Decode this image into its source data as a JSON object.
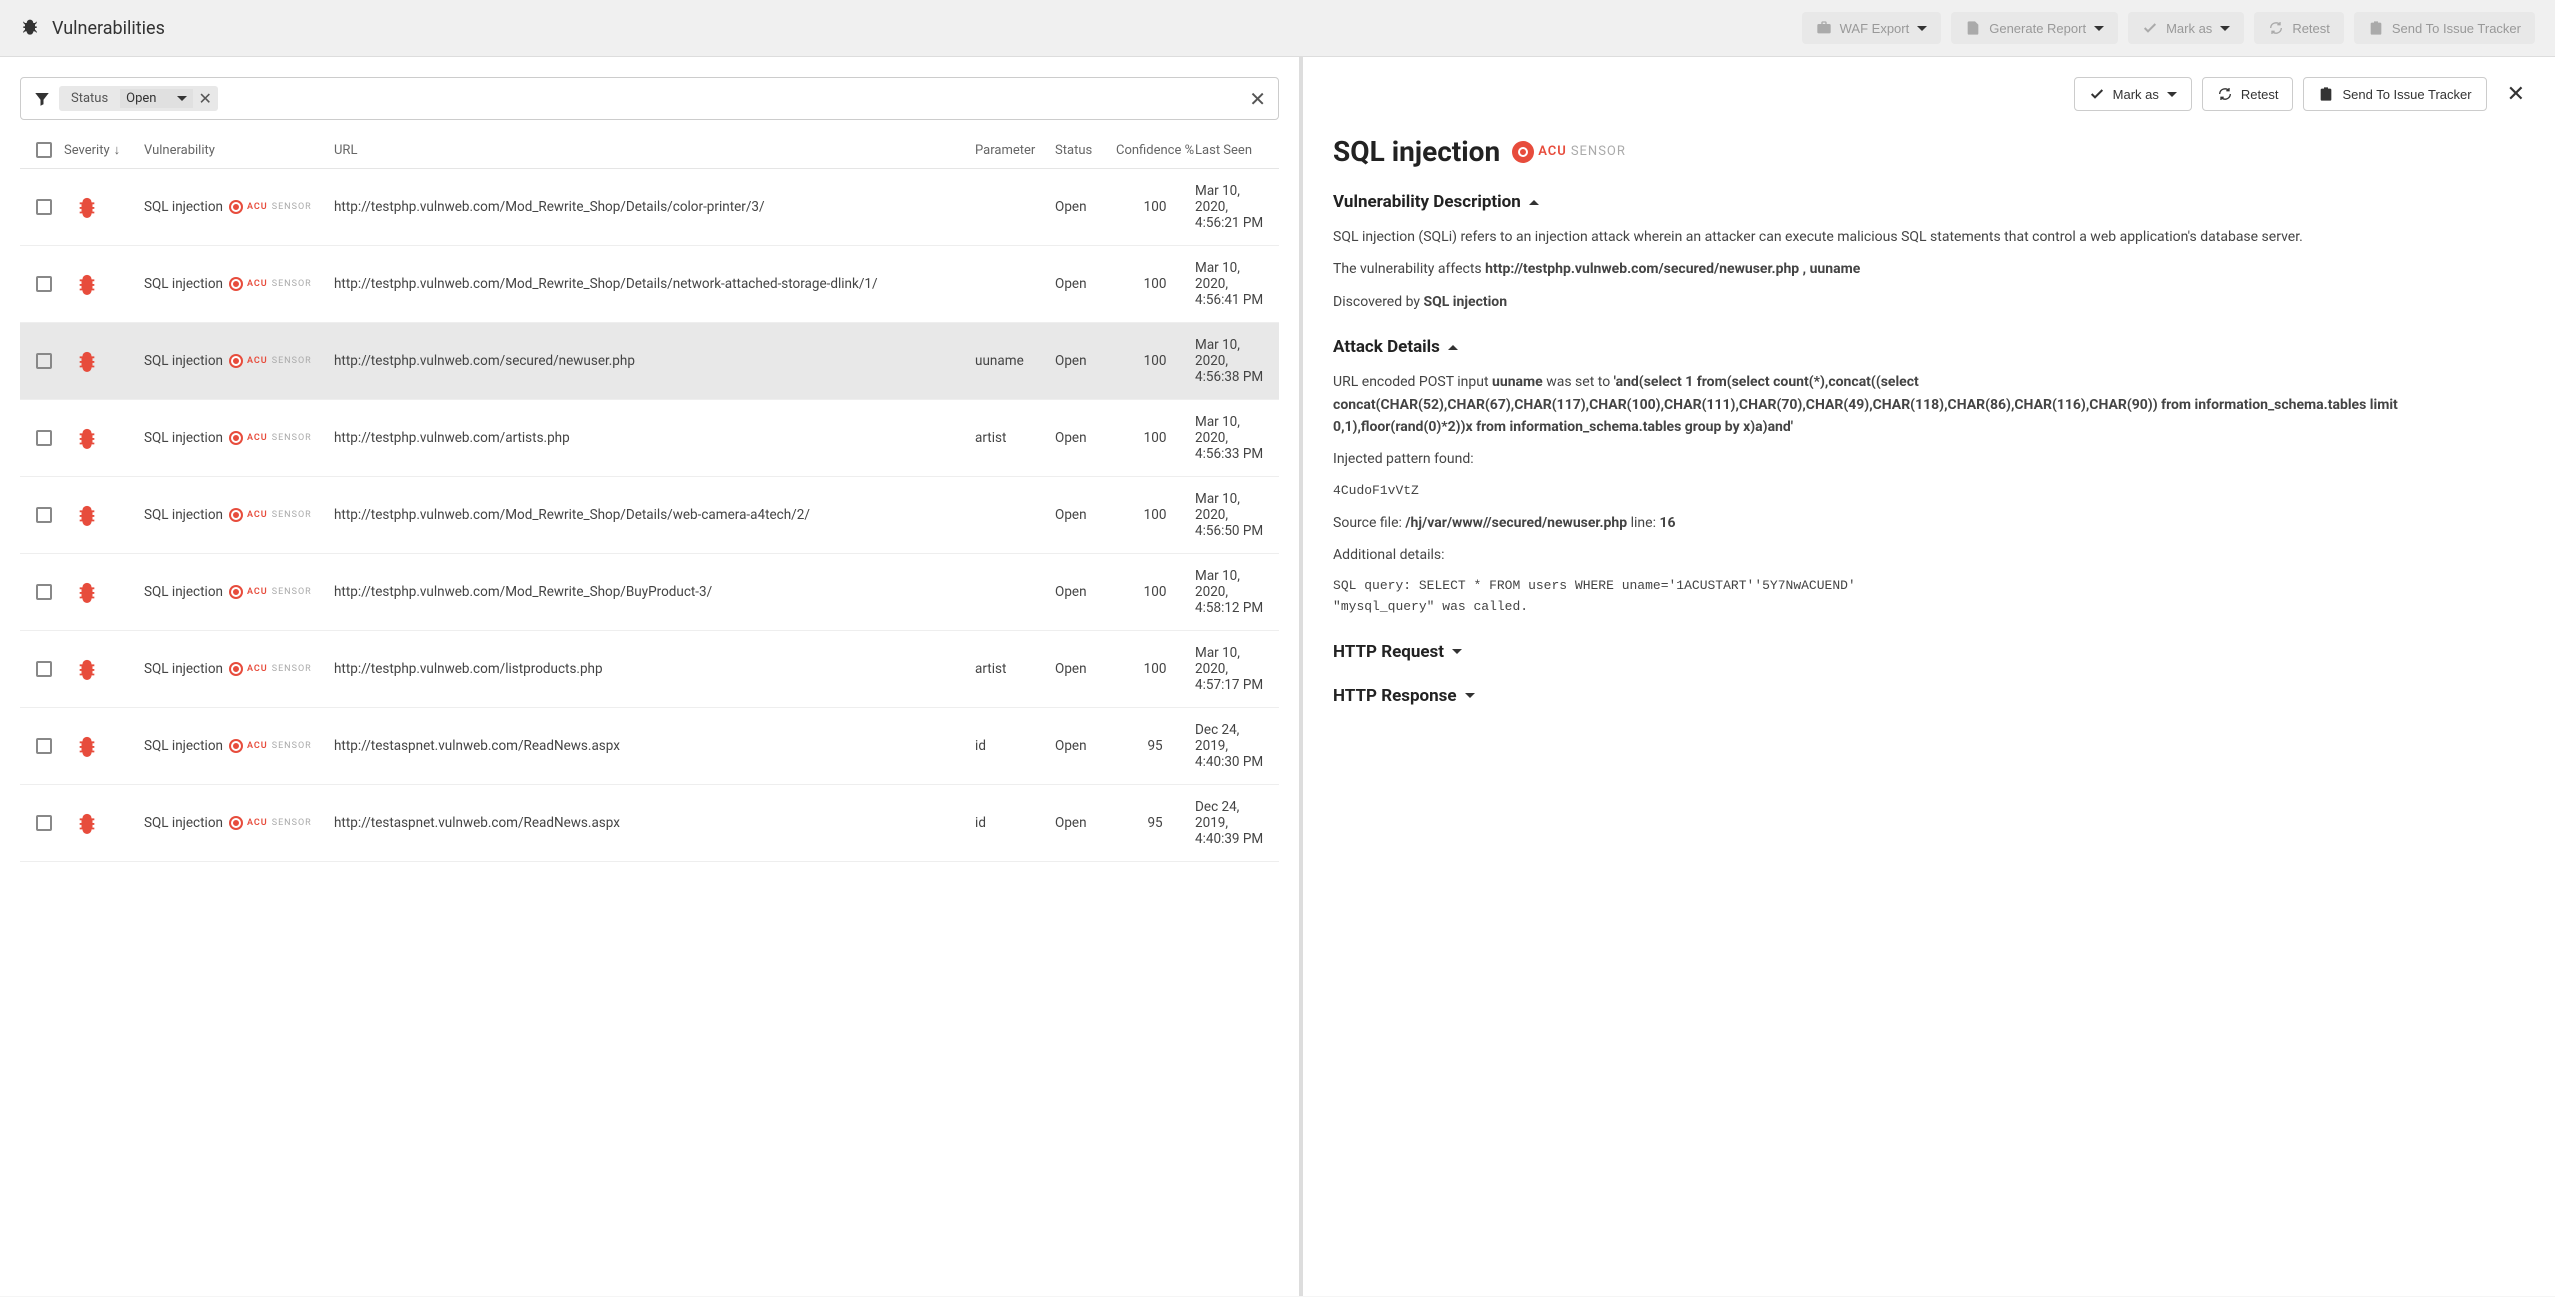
{
  "header": {
    "title": "Vulnerabilities",
    "buttons": {
      "waf_export": "WAF Export",
      "generate_report": "Generate Report",
      "mark_as": "Mark as",
      "retest": "Retest",
      "send_tracker": "Send To Issue Tracker"
    }
  },
  "filter": {
    "label": "Status",
    "value": "Open"
  },
  "columns": {
    "severity": "Severity",
    "vulnerability": "Vulnerability",
    "url": "URL",
    "parameter": "Parameter",
    "status": "Status",
    "confidence": "Confidence %",
    "last_seen": "Last Seen"
  },
  "rows": [
    {
      "vuln": "SQL injection",
      "url": "http://testphp.vulnweb.com/Mod_Rewrite_Shop/Details/color-printer/3/",
      "param": "",
      "status": "Open",
      "conf": "100",
      "seen": "Mar 10, 2020, 4:56:21 PM"
    },
    {
      "vuln": "SQL injection",
      "url": "http://testphp.vulnweb.com/Mod_Rewrite_Shop/Details/network-attached-storage-dlink/1/",
      "param": "",
      "status": "Open",
      "conf": "100",
      "seen": "Mar 10, 2020, 4:56:41 PM"
    },
    {
      "vuln": "SQL injection",
      "url": "http://testphp.vulnweb.com/secured/newuser.php",
      "param": "uuname",
      "status": "Open",
      "conf": "100",
      "seen": "Mar 10, 2020, 4:56:38 PM",
      "selected": true
    },
    {
      "vuln": "SQL injection",
      "url": "http://testphp.vulnweb.com/artists.php",
      "param": "artist",
      "status": "Open",
      "conf": "100",
      "seen": "Mar 10, 2020, 4:56:33 PM"
    },
    {
      "vuln": "SQL injection",
      "url": "http://testphp.vulnweb.com/Mod_Rewrite_Shop/Details/web-camera-a4tech/2/",
      "param": "",
      "status": "Open",
      "conf": "100",
      "seen": "Mar 10, 2020, 4:56:50 PM"
    },
    {
      "vuln": "SQL injection",
      "url": "http://testphp.vulnweb.com/Mod_Rewrite_Shop/BuyProduct-3/",
      "param": "",
      "status": "Open",
      "conf": "100",
      "seen": "Mar 10, 2020, 4:58:12 PM"
    },
    {
      "vuln": "SQL injection",
      "url": "http://testphp.vulnweb.com/listproducts.php",
      "param": "artist",
      "status": "Open",
      "conf": "100",
      "seen": "Mar 10, 2020, 4:57:17 PM"
    },
    {
      "vuln": "SQL injection",
      "url": "http://testaspnet.vulnweb.com/ReadNews.aspx",
      "param": "id",
      "status": "Open",
      "conf": "95",
      "seen": "Dec 24, 2019, 4:40:30 PM"
    },
    {
      "vuln": "SQL injection",
      "url": "http://testaspnet.vulnweb.com/ReadNews.aspx",
      "param": "id",
      "status": "Open",
      "conf": "95",
      "seen": "Dec 24, 2019, 4:40:39 PM"
    }
  ],
  "detail": {
    "actions": {
      "mark_as": "Mark as",
      "retest": "Retest",
      "send_tracker": "Send To Issue Tracker"
    },
    "title": "SQL injection",
    "sections": {
      "desc_title": "Vulnerability Description",
      "desc_p1": "SQL injection (SQLi) refers to an injection attack wherein an attacker can execute malicious SQL statements that control a web application's database server.",
      "desc_p2_pre": "The vulnerability affects ",
      "desc_p2_bold": "http://testphp.vulnweb.com/secured/newuser.php , uuname",
      "desc_p3_pre": "Discovered by ",
      "desc_p3_bold": "SQL injection",
      "attack_title": "Attack Details",
      "attack_pre": "URL encoded POST input ",
      "attack_input": "uuname",
      "attack_mid": " was set to ",
      "attack_payload": "'and(select 1 from(select count(*),concat((select concat(CHAR(52),CHAR(67),CHAR(117),CHAR(100),CHAR(111),CHAR(70),CHAR(49),CHAR(118),CHAR(86),CHAR(116),CHAR(90)) from information_schema.tables limit 0,1),floor(rand(0)*2))x from information_schema.tables group by x)a)and'",
      "injected_label": "Injected pattern found:",
      "injected_val": "4CudoF1vVtZ",
      "source_pre": "Source file: ",
      "source_file": "/hj/var/www//secured/newuser.php",
      "source_line_pre": " line: ",
      "source_line": "16",
      "additional_label": "Additional details:",
      "additional_mono": "SQL query: SELECT * FROM users WHERE uname='1ACUSTART''5Y7NwACUEND'\n\"mysql_query\" was called.",
      "http_req": "HTTP Request",
      "http_res": "HTTP Response"
    }
  }
}
